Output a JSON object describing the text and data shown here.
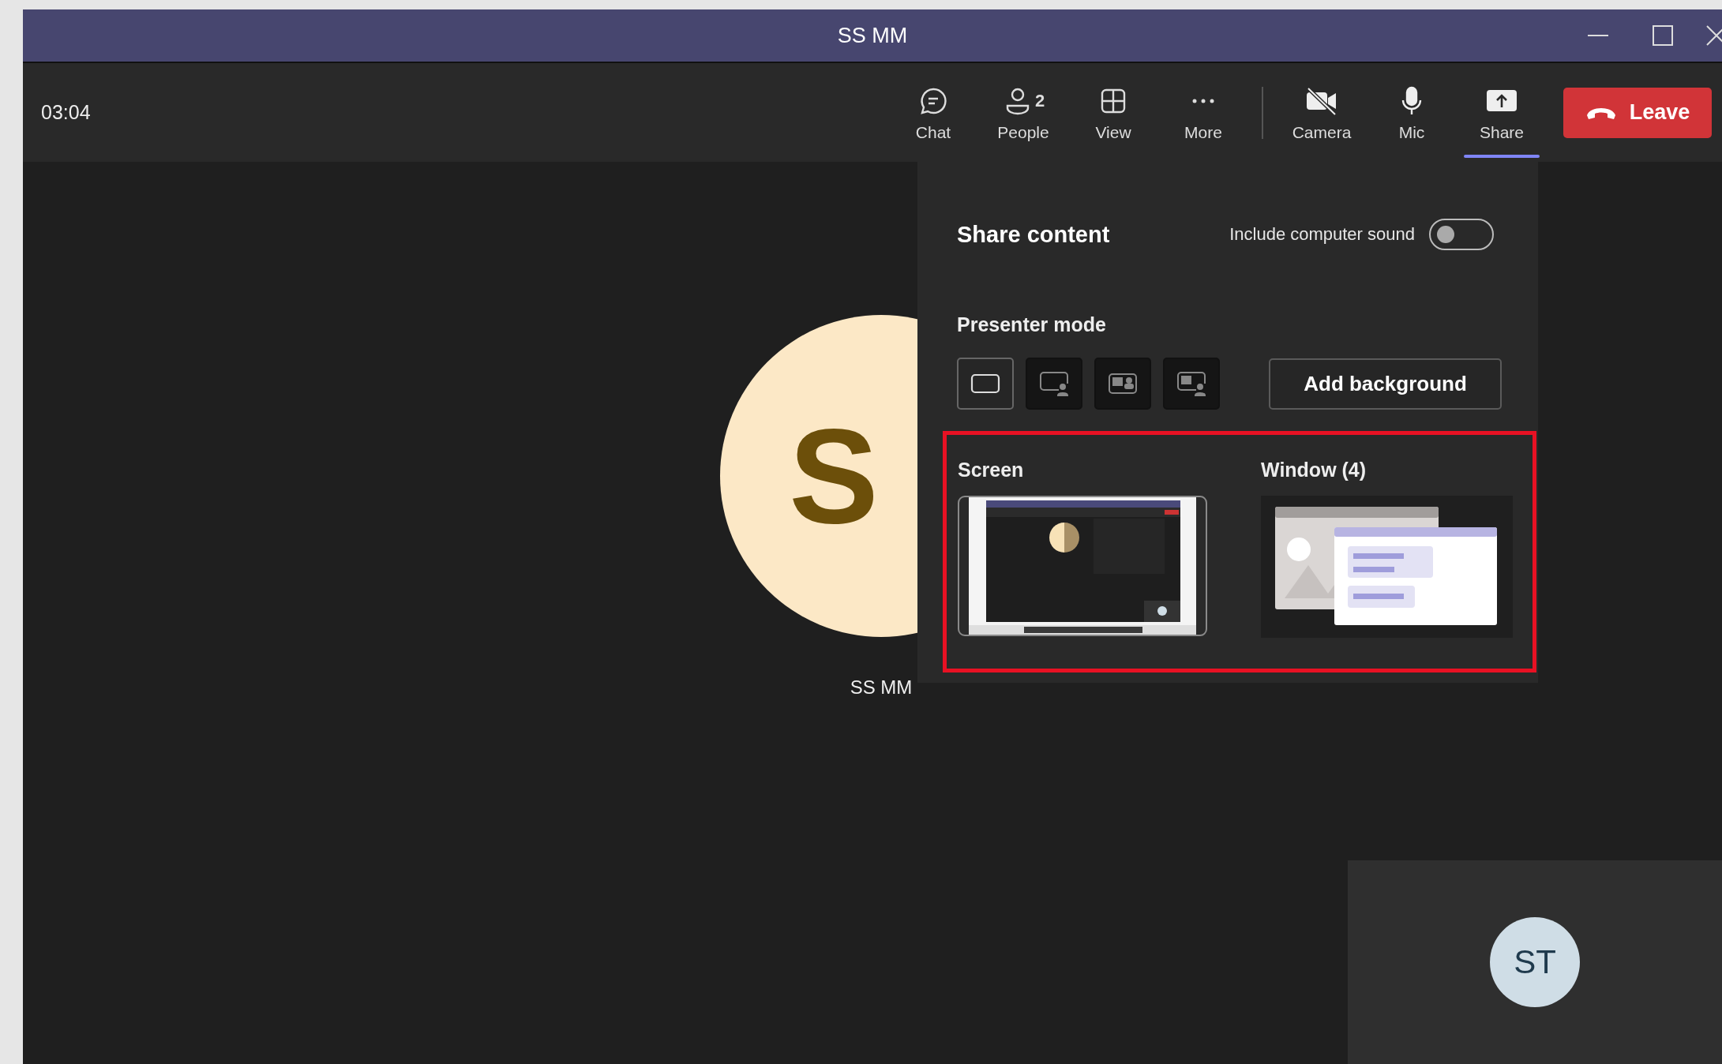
{
  "window": {
    "title": "SS MM"
  },
  "toolbar": {
    "timer": "03:04",
    "items": [
      {
        "kind": "chat",
        "label": "Chat",
        "selected": false
      },
      {
        "kind": "people",
        "label": "People",
        "count": "2",
        "selected": false
      },
      {
        "kind": "view",
        "label": "View",
        "selected": false
      },
      {
        "kind": "more",
        "label": "More",
        "selected": false
      },
      {
        "kind": "camera-off",
        "label": "Camera",
        "selected": false
      },
      {
        "kind": "mic",
        "label": "Mic",
        "selected": false
      },
      {
        "kind": "share",
        "label": "Share",
        "selected": true
      }
    ],
    "leave": "Leave"
  },
  "stage": {
    "participant": {
      "initials": "S",
      "name": "SS MM"
    },
    "self_tile": {
      "initials": "ST"
    }
  },
  "share_panel": {
    "title": "Share content",
    "sound": {
      "label": "Include computer sound",
      "on": false
    },
    "presenter_mode": {
      "title": "Presenter mode",
      "modes": [
        {
          "kind": "content-only",
          "selected": true
        },
        {
          "kind": "standout",
          "selected": false
        },
        {
          "kind": "side-by-side",
          "selected": false
        },
        {
          "kind": "reporter",
          "selected": false
        }
      ],
      "add_background": "Add background"
    },
    "sources_highlighted": true,
    "sources": [
      {
        "kind": "screen",
        "label": "Screen"
      },
      {
        "kind": "window",
        "label": "Window (4)"
      }
    ]
  }
}
